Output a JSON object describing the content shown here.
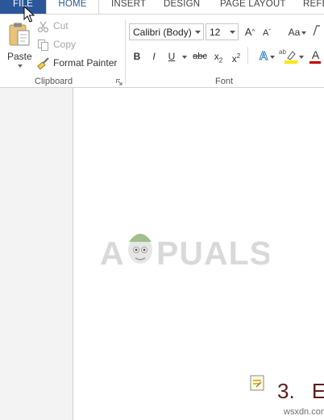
{
  "tabs": [
    {
      "label": "FILE"
    },
    {
      "label": "HOME"
    },
    {
      "label": "INSERT"
    },
    {
      "label": "DESIGN"
    },
    {
      "label": "PAGE LAYOUT"
    },
    {
      "label": "REFE"
    }
  ],
  "clipboard": {
    "group_label": "Clipboard",
    "paste_label": "Paste",
    "cut_label": "Cut",
    "copy_label": "Copy",
    "format_painter_label": "Format Painter"
  },
  "font": {
    "group_label": "Font",
    "font_name": "Calibri (Body)",
    "font_size": "12",
    "bold": "B",
    "italic": "I",
    "underline": "U",
    "strikethrough": "abc",
    "subscript_base": "x",
    "subscript_mark": "2",
    "superscript_base": "x",
    "superscript_mark": "2",
    "grow": "A",
    "shrink": "A",
    "change_case": "Aa",
    "effects": "A",
    "font_color": "A",
    "highlight": "ab"
  },
  "document": {
    "heading_number": "3.",
    "heading_start": "E"
  },
  "watermark": {
    "text_left": "A",
    "text_right": "PUALS"
  },
  "site_mark": "wsxdn.com",
  "colors": {
    "file_tab_bg": "#2b579a",
    "accent": "#2b579a",
    "heading": "#5b1e1e",
    "highlight_bar": "#ffe600",
    "font_color_bar": "#c00000"
  }
}
